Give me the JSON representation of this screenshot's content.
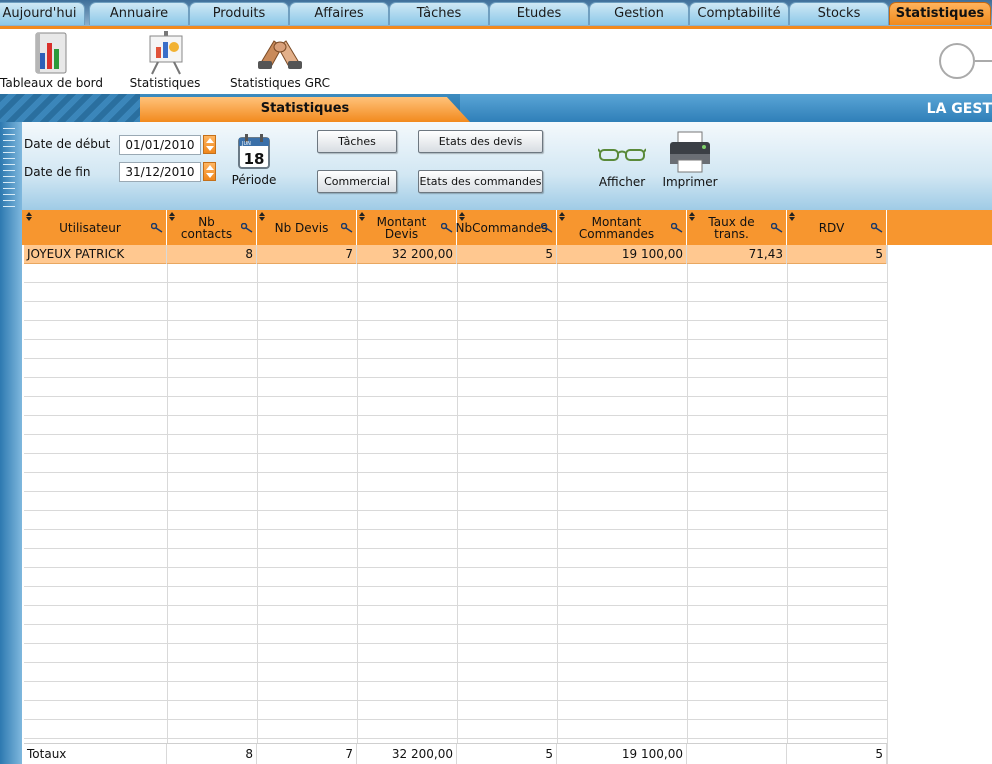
{
  "tabs": [
    {
      "label": "Aujourd'hui",
      "active": false
    },
    {
      "label": "Annuaire",
      "active": false
    },
    {
      "label": "Produits",
      "active": false
    },
    {
      "label": "Affaires",
      "active": false
    },
    {
      "label": "Tâches",
      "active": false
    },
    {
      "label": "Etudes",
      "active": false
    },
    {
      "label": "Gestion",
      "active": false
    },
    {
      "label": "Comptabilité",
      "active": false
    },
    {
      "label": "Stocks",
      "active": false
    },
    {
      "label": "Statistiques",
      "active": true
    }
  ],
  "toolbar": {
    "dashboard": {
      "label": "Tableaux de bord",
      "icon": "bar-chart-book-icon"
    },
    "statistics": {
      "label": "Statistiques",
      "icon": "presentation-board-icon"
    },
    "crm_statistics": {
      "label": "Statistiques GRC",
      "icon": "handshake-icon"
    }
  },
  "banner": {
    "title": "Statistiques",
    "brand": "LA GEST"
  },
  "filters": {
    "start_label": "Date de début",
    "start_value": "01/01/2010",
    "end_label": "Date de fin",
    "end_value": "31/12/2010",
    "period_label": "Période",
    "period_icon": "calendar-icon",
    "calendar_day": "18",
    "calendar_month": "JUN"
  },
  "actions": {
    "tasks": "Tâches",
    "sales": "Commercial",
    "quotes_status": "Etats des devis",
    "orders_status": "Etats des commandes",
    "show": "Afficher",
    "show_icon": "glasses-icon",
    "print": "Imprimer",
    "print_icon": "printer-icon"
  },
  "table": {
    "columns": [
      "Utilisateur",
      "Nb contacts",
      "Nb Devis",
      "Montant Devis",
      "NbCommandes",
      "Montant\nCommandes",
      "Taux de trans.",
      "RDV"
    ],
    "rows": [
      [
        "JOYEUX PATRICK",
        "8",
        "7",
        "32 200,00",
        "5",
        "19 100,00",
        "71,43",
        "5"
      ]
    ],
    "totals": [
      "Totaux",
      "8",
      "7",
      "32 200,00",
      "5",
      "19 100,00",
      "",
      "5"
    ]
  },
  "colors": {
    "accent_orange": "#f7962f",
    "selected_row": "#ffc890",
    "banner_blue": "#2f7fb8"
  }
}
